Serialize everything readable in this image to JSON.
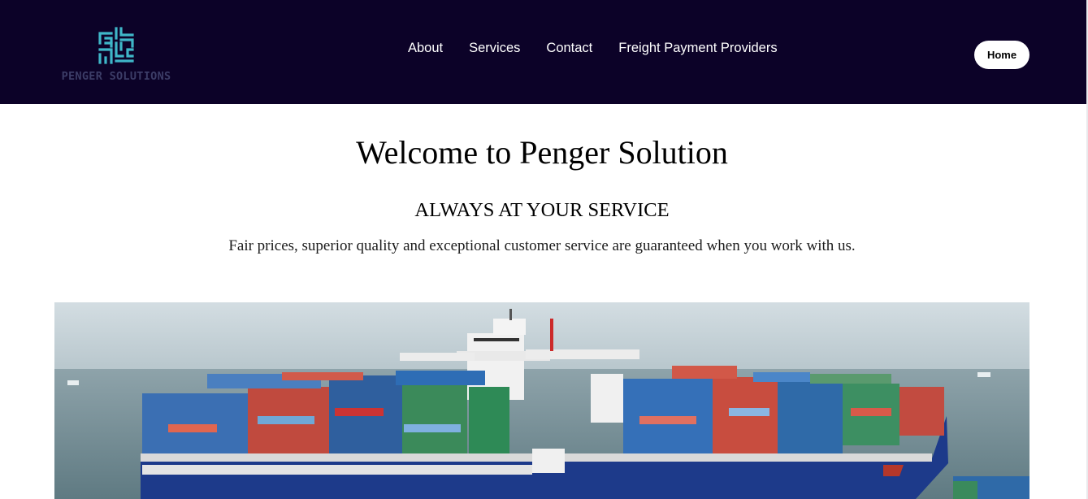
{
  "brand": {
    "name": "PENGER SOLUTIONS",
    "mark_color": "#3fb6c8"
  },
  "nav": {
    "items": [
      "About",
      "Services",
      "Contact",
      "Freight Payment Providers"
    ]
  },
  "home_button": "Home",
  "hero": {
    "title": "Welcome to Penger Solution",
    "tagline": "ALWAYS AT YOUR SERVICE",
    "description": "Fair prices, superior quality and exceptional customer service are guaranteed when you work with us."
  },
  "colors": {
    "topbar": "#0c0228",
    "hull": "#1d3a8a",
    "sea": "#6f8a92"
  }
}
